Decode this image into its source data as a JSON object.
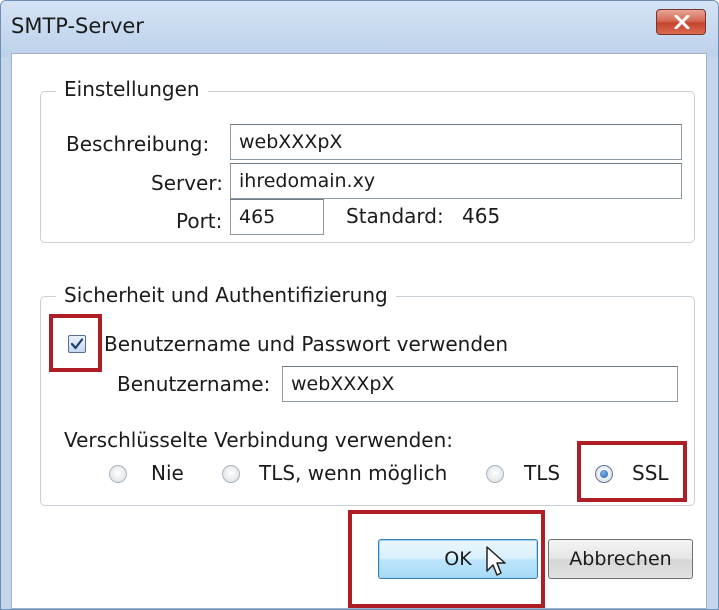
{
  "window": {
    "title": "SMTP-Server"
  },
  "settings": {
    "legend": "Einstellungen",
    "description_label": "Beschreibung:",
    "description_value": "webXXXpX",
    "server_label": "Server:",
    "server_value": "ihredomain.xy",
    "port_label": "Port:",
    "port_value": "465",
    "default_label": "Standard:",
    "default_value": "465"
  },
  "security": {
    "legend": "Sicherheit und Authentifizierung",
    "use_credentials_label": "Benutzername und Passwort verwenden",
    "use_credentials_checked": true,
    "username_label": "Benutzername:",
    "username_value": "webXXXpX",
    "encryption_label": "Verschlüsselte Verbindung verwenden:",
    "encryption_options": [
      {
        "label": "Nie",
        "checked": false
      },
      {
        "label": "TLS, wenn möglich",
        "checked": false
      },
      {
        "label": "TLS",
        "checked": false
      },
      {
        "label": "SSL",
        "checked": true
      }
    ]
  },
  "buttons": {
    "ok_label": "OK",
    "cancel_label": "Abbrechen"
  },
  "colors": {
    "highlight": "#b01e25",
    "title_bar": "#c3d6ec",
    "default_button_border": "#3c7fb1"
  },
  "icons": {
    "close": "close-icon",
    "check": "checkmark-icon",
    "cursor": "mouse-pointer-icon"
  }
}
